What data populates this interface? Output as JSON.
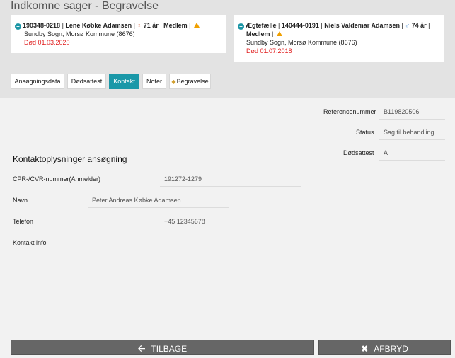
{
  "page_title": "Indkomne sager - Begravelse",
  "cards": [
    {
      "icon": "plus-circle-icon",
      "cpr": "190348-0218",
      "name": "Lene Købke Adamsen",
      "gender_icon": "female-icon",
      "age": "71 år",
      "member": "Medlem",
      "address": "Sundby Sogn, Morsø Kommune (8676)",
      "death": "Død 01.03.2020"
    },
    {
      "icon": "plus-circle-icon",
      "relation": "Ægtefælle",
      "cpr": "140444-0191",
      "name": "Niels Valdemar Adamsen",
      "gender_icon": "male-icon",
      "age": "74 år",
      "member": "Medlem",
      "address": "Sundby Sogn, Morsø Kommune (8676)",
      "death": "Død 01.07.2018"
    }
  ],
  "tabs": [
    {
      "label": "Ansøgningsdata",
      "active": false
    },
    {
      "label": "Dødsattest",
      "active": false
    },
    {
      "label": "Kontakt",
      "active": true
    },
    {
      "label": "Noter",
      "active": false
    },
    {
      "label": "Begravelse",
      "active": false,
      "icon": "dot-icon"
    }
  ],
  "info": {
    "reference_label": "Referencenummer",
    "reference_value": "B119820506",
    "status_label": "Status",
    "status_value": "Sag til behandling",
    "dodsattest_label": "Dødsattest",
    "dodsattest_value": "A"
  },
  "contact": {
    "title": "Kontaktoplysninger ansøgning",
    "cpr_label": "CPR-/CVR-nummer(Anmelder)",
    "cpr_value": "191272-1279",
    "name_label": "Navn",
    "name_value": "Peter Andreas Købke Adamsen",
    "phone_label": "Telefon",
    "phone_value": "+45 12345678",
    "info_label": "Kontakt info",
    "info_value": ""
  },
  "buttons": {
    "back_label": "TILBAGE",
    "cancel_label": "AFBRYD"
  },
  "colors": {
    "accent": "#1a98a8",
    "death": "#e01b1b",
    "button": "#666666"
  }
}
